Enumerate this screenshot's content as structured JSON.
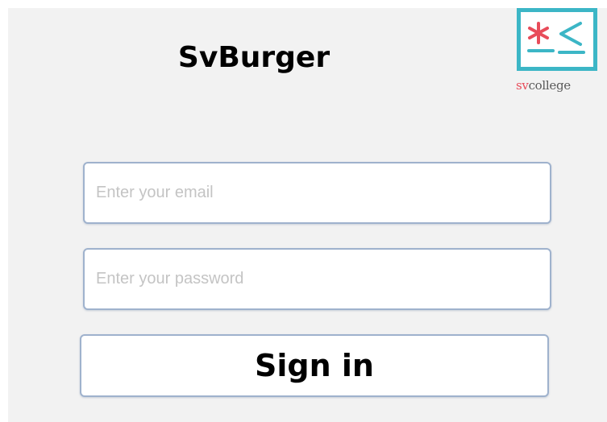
{
  "app": {
    "title": "SvBurger"
  },
  "logo": {
    "text_sv": "sv",
    "text_college": "college",
    "icon": "svcollege-logo-icon",
    "border_color": "#3cb6c6",
    "accent_color": "#e84c5a"
  },
  "login_form": {
    "email": {
      "placeholder": "Enter your email",
      "value": ""
    },
    "password": {
      "placeholder": "Enter your password",
      "value": ""
    },
    "sign_in_label": "Sign in"
  },
  "colors": {
    "background": "#f2f2f2",
    "field_border": "#9fb2cd",
    "placeholder": "#c4c4c4"
  }
}
